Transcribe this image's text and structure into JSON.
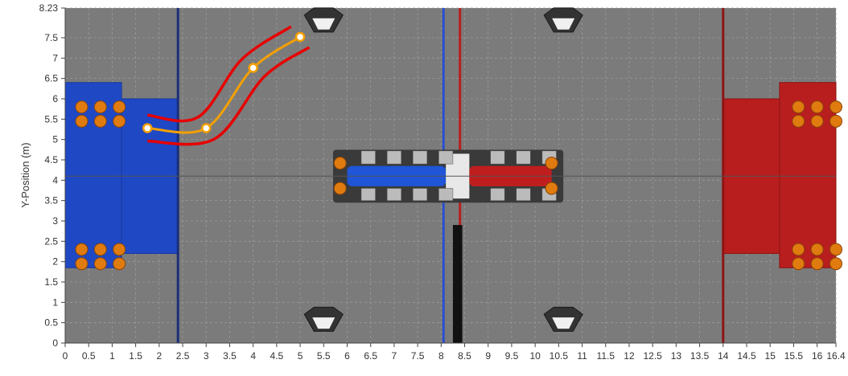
{
  "plot": {
    "x_axis": {
      "min": 0,
      "max": 16.4,
      "ticks": [
        "0",
        "0.5",
        "1",
        "1.5",
        "2",
        "2.5",
        "3",
        "3.5",
        "4",
        "4.5",
        "5",
        "5.5",
        "6",
        "6.5",
        "7",
        "7.5",
        "8",
        "8.5",
        "9",
        "9.5",
        "10",
        "10.5",
        "11",
        "11.5",
        "12",
        "12.5",
        "13",
        "13.5",
        "14",
        "14.5",
        "15",
        "15.5",
        "16",
        "16.4"
      ]
    },
    "y_axis": {
      "label": "Y-Position (m)",
      "min": 0,
      "max": 8.23,
      "ticks": [
        "0",
        "0.5",
        "1",
        "1.5",
        "2",
        "2.5",
        "3",
        "3.5",
        "4",
        "4.5",
        "5",
        "5.5",
        "6",
        "6.5",
        "7",
        "7.5",
        "8.23"
      ]
    },
    "grid": true,
    "colors": {
      "field": "#7b7b7b",
      "grid": "#9a9a9a",
      "blue_alliance": "#1f48c4",
      "red_alliance": "#b81e1e",
      "path": "#f5a000",
      "path_bounds": "#e60000",
      "coral": "#e07b10"
    }
  },
  "path": {
    "points": [
      [
        1.75,
        5.28
      ],
      [
        3.0,
        5.28
      ],
      [
        4.0,
        6.76
      ],
      [
        5.0,
        7.52
      ]
    ],
    "bound_offset": 0.32
  },
  "field_elements": {
    "blue_start_line_x": 2.4,
    "red_start_line_x": 14.0,
    "blue_center_line_x": 8.05,
    "red_center_line_x": 8.4,
    "dark_stripe_x": [
      8.25,
      8.45
    ],
    "coral_blue_top": [
      [
        0.15,
        5.8
      ],
      [
        0.55,
        5.8
      ],
      [
        0.95,
        5.8
      ],
      [
        0.15,
        5.45
      ],
      [
        0.55,
        5.45
      ],
      [
        0.95,
        5.45
      ]
    ],
    "coral_blue_bottom": [
      [
        0.15,
        2.3
      ],
      [
        0.55,
        2.3
      ],
      [
        0.95,
        2.3
      ],
      [
        0.15,
        1.95
      ],
      [
        0.55,
        1.95
      ],
      [
        0.95,
        1.95
      ]
    ],
    "coral_red_top": [
      [
        15.4,
        5.8
      ],
      [
        15.8,
        5.8
      ],
      [
        16.2,
        5.8
      ],
      [
        15.4,
        5.45
      ],
      [
        15.8,
        5.45
      ],
      [
        16.2,
        5.45
      ]
    ],
    "coral_red_bottom": [
      [
        15.4,
        2.3
      ],
      [
        15.8,
        2.3
      ],
      [
        16.2,
        2.3
      ],
      [
        15.4,
        1.95
      ],
      [
        15.8,
        1.95
      ],
      [
        16.2,
        1.95
      ]
    ],
    "coral_center": [
      [
        5.85,
        4.42
      ],
      [
        5.85,
        3.8
      ],
      [
        10.35,
        4.42
      ],
      [
        10.35,
        3.8
      ]
    ]
  }
}
